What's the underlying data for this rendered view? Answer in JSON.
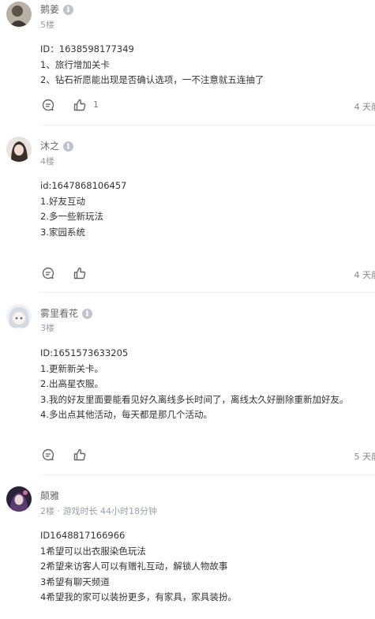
{
  "posts": [
    {
      "name": "鹅姜",
      "floor": "5楼",
      "lines": [
        "ID：1638598177349",
        "1、旅行增加关卡",
        "2、钻石祈愿能出现是否确认选项，一不注意就五连抽了"
      ],
      "likes": "1",
      "time": "4 天前"
    },
    {
      "name": "沐之",
      "floor": "4楼",
      "lines": [
        "id:1647868106457",
        "1.好友互动",
        "2.多一些新玩法",
        "3.家园系统"
      ],
      "likes": "",
      "time": "4 天前"
    },
    {
      "name": "雾里看花",
      "floor": "3楼",
      "lines": [
        "ID:1651573633205",
        "1.更新新关卡。",
        "2.出高星衣服。",
        "3.我的好友里面要能看见好久离线多长时间了，离线太久好删除重新加好友。",
        "4.多出点其他活动，每天都是那几个活动。"
      ],
      "likes": "",
      "time": "5 天前"
    },
    {
      "name": "颠雅",
      "floor": "2楼 · 游戏时长 44小时18分钟",
      "lines": [
        "ID1648817166966",
        "1希望可以出衣服染色玩法",
        "2希望来访客人可以有赠礼互动，解锁人物故事",
        "3希望有聊天频道",
        "4希望我的家可以装扮更多，有家具，家具装扮。"
      ],
      "likes": "",
      "time": ""
    }
  ],
  "badge_icon": "verified-badge-icon",
  "icons": {
    "comment": "comment-bubble-icon",
    "like": "thumbs-up-icon"
  },
  "colors": {
    "text": "#333333",
    "meta": "#9aa0a6",
    "divider": "#eeeeee"
  }
}
